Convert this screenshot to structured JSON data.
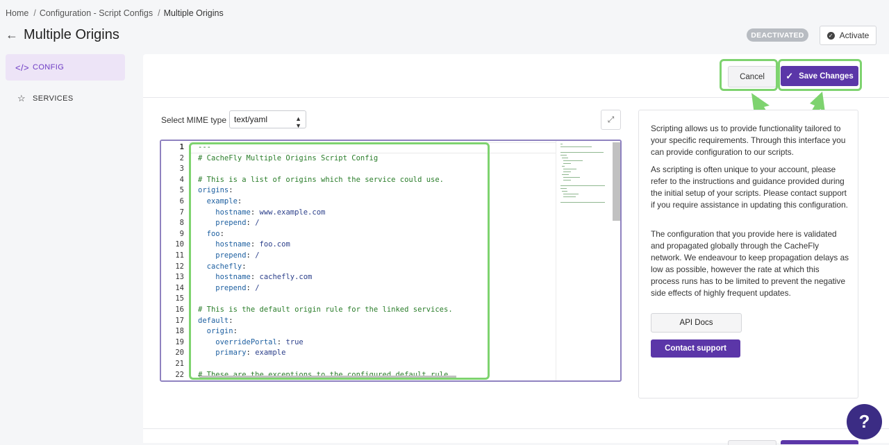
{
  "breadcrumb": {
    "items": [
      "Home",
      "Configuration - Script Configs",
      "Multiple Origins"
    ],
    "separator": "/"
  },
  "header": {
    "title": "Multiple Origins",
    "status_badge": "DEACTIVATED",
    "activate_label": "Activate"
  },
  "sidebar": {
    "items": [
      {
        "label": "CONFIG",
        "icon": "code-icon",
        "active": true
      },
      {
        "label": "SERVICES",
        "icon": "star-icon",
        "active": false
      }
    ]
  },
  "toolbar": {
    "cancel_label": "Cancel",
    "save_label": "Save Changes"
  },
  "editor": {
    "mime_label": "Select MIME type",
    "mime_value": "text/yaml",
    "lines": [
      "---",
      "# CacheFly Multiple Origins Script Config",
      "",
      "# This is a list of origins which the service could use.",
      "origins:",
      "  example:",
      "    hostname: www.example.com",
      "    prepend: /",
      "  foo:",
      "    hostname: foo.com",
      "    prepend: /",
      "  cachefly:",
      "    hostname: cachefly.com",
      "    prepend: /",
      "",
      "# This is the default origin rule for the linked services.",
      "default:",
      "  origin:",
      "    overridePortal: true",
      "    primary: example",
      "",
      "# These are the exceptions to the configured default rule."
    ]
  },
  "info": {
    "paragraphs": [
      "Scripting allows us to provide functionality tailored to your specific requirements. Through this interface you can provide configuration to our scripts.",
      "As scripting is often unique to your account, please refer to the instructions and guidance provided during the initial setup of your scripts. Please contact support if you require assistance in updating this configuration.",
      "The configuration that you provide here is validated and propagated globally through the CacheFly network. We endeavour to keep propagation delays as low as possible, however the rate at which this process runs has to be limited to prevent the negative side effects of highly frequent updates."
    ],
    "api_docs_label": "API Docs",
    "contact_support_label": "Contact support"
  },
  "help": {
    "label": "?"
  },
  "colors": {
    "accent": "#5b36a8",
    "highlight": "#7ed36f",
    "sidebar_active_bg": "#ede4f7"
  }
}
